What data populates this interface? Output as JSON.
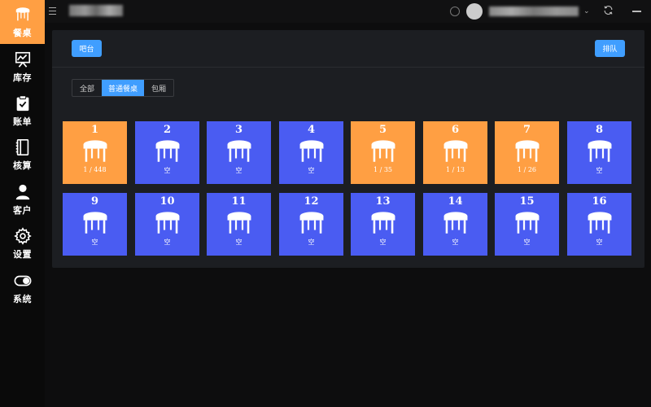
{
  "sidebar": {
    "items": [
      {
        "label": "餐桌",
        "icon": "table-icon",
        "active": true
      },
      {
        "label": "库存",
        "icon": "chart-board-icon",
        "active": false
      },
      {
        "label": "账单",
        "icon": "clipboard-check-icon",
        "active": false
      },
      {
        "label": "核算",
        "icon": "ledger-icon",
        "active": false
      },
      {
        "label": "客户",
        "icon": "user-icon",
        "active": false
      },
      {
        "label": "设置",
        "icon": "gear-icon",
        "active": false
      },
      {
        "label": "系统",
        "icon": "toggle-icon",
        "active": false
      }
    ]
  },
  "topbar": {
    "store_name": "••••••",
    "user_name": "••••••••••••"
  },
  "panel": {
    "bar_button": "吧台",
    "queue_button": "排队",
    "tabs": [
      {
        "label": "全部",
        "active": false
      },
      {
        "label": "普通餐桌",
        "active": true
      },
      {
        "label": "包厢",
        "active": false
      }
    ]
  },
  "tables": [
    {
      "number": "1",
      "status": "1 / 448",
      "occupied": true
    },
    {
      "number": "2",
      "status": "空",
      "occupied": false
    },
    {
      "number": "3",
      "status": "空",
      "occupied": false
    },
    {
      "number": "4",
      "status": "空",
      "occupied": false
    },
    {
      "number": "5",
      "status": "1 / 35",
      "occupied": true
    },
    {
      "number": "6",
      "status": "1 / 13",
      "occupied": true
    },
    {
      "number": "7",
      "status": "1 / 26",
      "occupied": true
    },
    {
      "number": "8",
      "status": "空",
      "occupied": false
    },
    {
      "number": "9",
      "status": "空",
      "occupied": false
    },
    {
      "number": "10",
      "status": "空",
      "occupied": false
    },
    {
      "number": "11",
      "status": "空",
      "occupied": false
    },
    {
      "number": "12",
      "status": "空",
      "occupied": false
    },
    {
      "number": "13",
      "status": "空",
      "occupied": false
    },
    {
      "number": "14",
      "status": "空",
      "occupied": false
    },
    {
      "number": "15",
      "status": "空",
      "occupied": false
    },
    {
      "number": "16",
      "status": "空",
      "occupied": false
    }
  ],
  "colors": {
    "accent_orange": "#ff9f43",
    "free_blue": "#4a5cf2",
    "button_blue": "#409eff"
  }
}
